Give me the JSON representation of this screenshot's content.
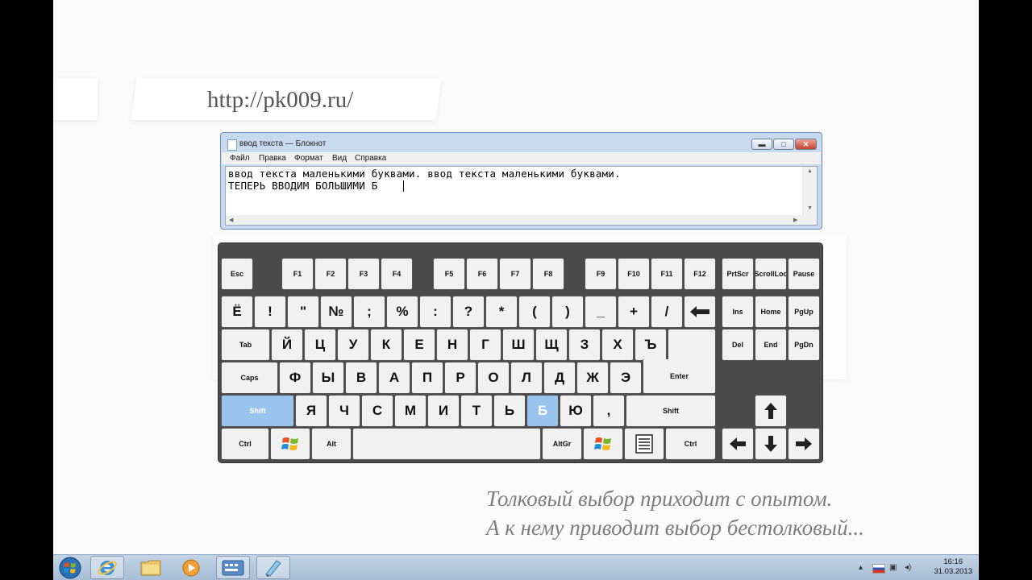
{
  "url": "http://pk009.ru/",
  "notepad": {
    "title": "ввод текста — Блокнот",
    "menu": [
      "Файл",
      "Правка",
      "Формат",
      "Вид",
      "Справка"
    ],
    "window_buttons": {
      "minimize": "▬",
      "maximize": "□",
      "close": "✕"
    },
    "lines": [
      "ввод текста маленькими буквами. ввод текста маленькими буквами.",
      "ТЕПЕРЬ ВВОДИМ БОЛЬШИМИ Б"
    ]
  },
  "keyboard": {
    "highlight_color": "#99c4ee",
    "rows": {
      "function": [
        "Esc",
        "F1",
        "F2",
        "F3",
        "F4",
        "F5",
        "F6",
        "F7",
        "F8",
        "F9",
        "F10",
        "F11",
        "F12",
        "PrtScr",
        "ScrollLoc",
        "Pause"
      ],
      "number": [
        "Ё",
        "!",
        "\"",
        "№",
        ";",
        "%",
        ":",
        "?",
        "*",
        "(",
        ")",
        "_",
        "+",
        "/",
        "Ins",
        "Home",
        "PgUp"
      ],
      "top": [
        "Tab",
        "Й",
        "Ц",
        "У",
        "К",
        "Е",
        "Н",
        "Г",
        "Ш",
        "Щ",
        "З",
        "Х",
        "Ъ",
        "Del",
        "End",
        "PgDn"
      ],
      "home": [
        "Caps",
        "Ф",
        "Ы",
        "В",
        "А",
        "П",
        "Р",
        "О",
        "Л",
        "Д",
        "Ж",
        "Э",
        "Enter"
      ],
      "bottom": [
        "Shift",
        "Я",
        "Ч",
        "С",
        "М",
        "И",
        "Т",
        "Ь",
        "Б",
        "Ю",
        ",",
        "Shift"
      ],
      "space": [
        "Ctrl",
        "Alt",
        "AltGr",
        "Ctrl"
      ]
    },
    "highlighted": [
      "Shift",
      "Б"
    ]
  },
  "quote": {
    "line1": "Толковый выбор приходит с опытом.",
    "line2": "А к нему приводит выбор бестолковый..."
  },
  "taskbar": {
    "time": "16:16",
    "date": "31.03.2013"
  }
}
